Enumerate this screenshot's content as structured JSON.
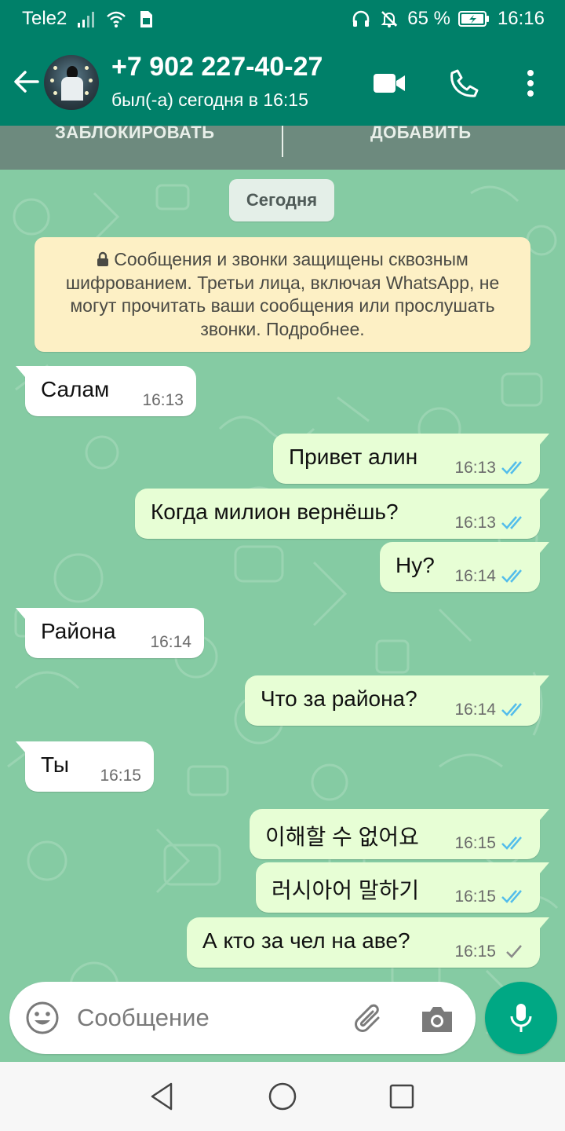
{
  "status_bar": {
    "carrier": "Tele2",
    "battery_percent": "65 %",
    "time": "16:16"
  },
  "header": {
    "contact_name": "+7 902 227-40-27",
    "last_seen": "был(-а) сегодня в 16:15"
  },
  "banner": {
    "block_label": "ЗАБЛОКИРОВАТЬ",
    "add_label": "ДОБАВИТЬ"
  },
  "chat": {
    "date_chip": "Сегодня",
    "encryption_notice": "Сообщения и звонки защищены сквозным шифрованием. Третьи лица, включая WhatsApp, не могут прочитать ваши сообщения или прослушать звонки. Подробнее.",
    "messages": [
      {
        "direction": "in",
        "text": "Салам",
        "time": "16:13"
      },
      {
        "direction": "out",
        "text": "Привет алин",
        "time": "16:13",
        "status": "read"
      },
      {
        "direction": "out",
        "text": "Когда милион вернёшь?",
        "time": "16:13",
        "status": "read"
      },
      {
        "direction": "out",
        "text": "Ну?",
        "time": "16:14",
        "status": "read"
      },
      {
        "direction": "in",
        "text": "Района",
        "time": "16:14"
      },
      {
        "direction": "out",
        "text": "Что за района?",
        "time": "16:14",
        "status": "read"
      },
      {
        "direction": "in",
        "text": "Ты",
        "time": "16:15"
      },
      {
        "direction": "out",
        "text": "이해할 수 없어요",
        "time": "16:15",
        "status": "read"
      },
      {
        "direction": "out",
        "text": "러시아어 말하기",
        "time": "16:15",
        "status": "read"
      },
      {
        "direction": "out",
        "text": "А кто за чел на аве?",
        "time": "16:15",
        "status": "sent"
      }
    ]
  },
  "composer": {
    "placeholder": "Сообщение"
  },
  "colors": {
    "header": "#008069",
    "chat_bg": "#85cba3",
    "outgoing_bubble": "#e7fed5",
    "incoming_bubble": "#ffffff",
    "read_ticks": "#53bdeb",
    "mic_button": "#00a884"
  },
  "icons": {
    "back": "arrow-left-icon",
    "video_call": "video-camera-icon",
    "voice_call": "phone-icon",
    "menu": "more-vertical-icon",
    "emoji": "emoji-smiley-icon",
    "attach": "paperclip-icon",
    "camera": "camera-icon",
    "mic": "microphone-icon"
  }
}
